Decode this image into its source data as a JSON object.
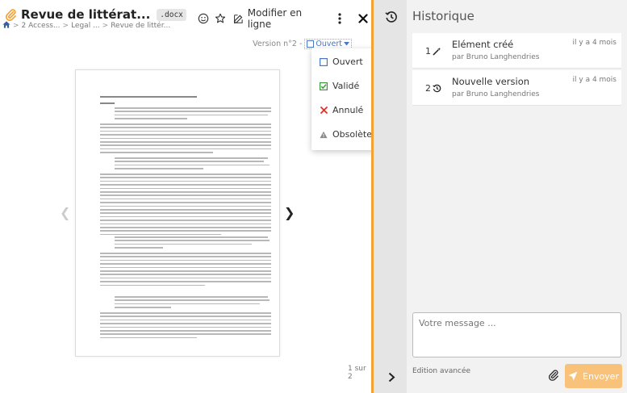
{
  "document": {
    "title": "Revue de littérat...",
    "extension": ".docx",
    "modify_label": "Modifier en ligne"
  },
  "breadcrumb": {
    "items": [
      "2 Access...",
      "Legal ...",
      "Revue de littér..."
    ]
  },
  "version": {
    "label": "Version n°2 -",
    "status": "Ouvert"
  },
  "status_options": [
    {
      "label": "Ouvert",
      "icon": "checkbox-empty-icon"
    },
    {
      "label": "Validé",
      "icon": "checkbox-checked-icon"
    },
    {
      "label": "Annulé",
      "icon": "cross-icon"
    },
    {
      "label": "Obsolète",
      "icon": "warning-icon"
    }
  ],
  "pager": {
    "count": "1 sur 2"
  },
  "history": {
    "title": "Historique",
    "items": [
      {
        "num": "1",
        "icon": "magic-wand-icon",
        "title": "Elément créé",
        "author": "par Bruno Langhendries",
        "time": "il y a 4 mois"
      },
      {
        "num": "2",
        "icon": "history-icon",
        "title": "Nouvelle version",
        "author": "par Bruno Langhendries",
        "time": "il y a 4 mois"
      }
    ]
  },
  "composer": {
    "placeholder": "Votre message ...",
    "advanced_label": "Edition avancée",
    "send_label": "Envoyer"
  },
  "colors": {
    "accent_orange": "#f3a233",
    "send_button": "#f8c27a",
    "status_blue": "#4a78c5",
    "validated_green": "#3a9a3a",
    "cancelled_red": "#d9342b"
  }
}
